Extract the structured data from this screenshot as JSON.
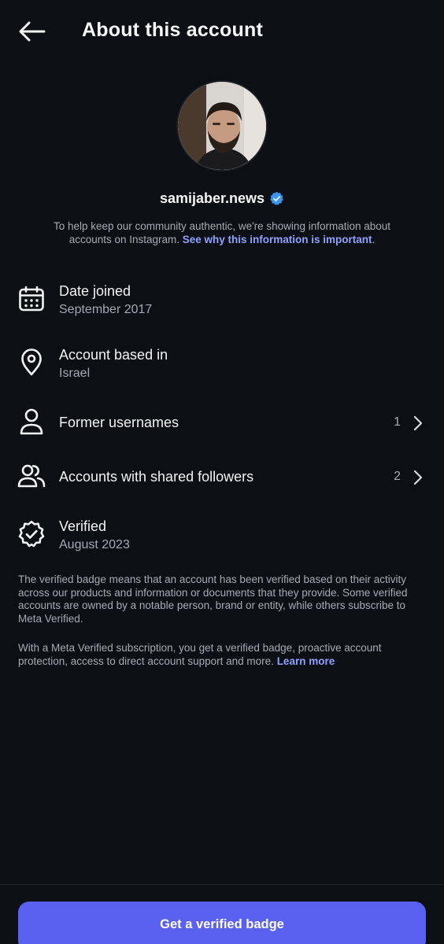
{
  "header": {
    "title": "About this account",
    "back_icon": "arrow-left-icon"
  },
  "profile": {
    "username": "samijaber.news",
    "verified_icon": "verified-badge-icon",
    "intro_text": "To help keep our community authentic, we're showing information about accounts on Instagram. ",
    "intro_link": "See why this information is important",
    "intro_end": "."
  },
  "rows": {
    "date_joined": {
      "title": "Date joined",
      "value": "September 2017",
      "icon": "calendar-icon"
    },
    "based_in": {
      "title": "Account based in",
      "value": "Israel",
      "icon": "location-pin-icon"
    },
    "former_usernames": {
      "title": "Former usernames",
      "count": "1",
      "icon": "person-icon"
    },
    "shared_followers": {
      "title": "Accounts with shared followers",
      "count": "2",
      "icon": "people-icon"
    },
    "verified": {
      "title": "Verified",
      "value": "August 2023",
      "icon": "verified-check-icon"
    }
  },
  "info": {
    "badge_paragraph": "The verified badge means that an account has been verified based on their activity across our products and information or documents that they provide. Some verified accounts are owned by a notable person, brand or entity, while others subscribe to Meta Verified.",
    "subscription_paragraph": "With a Meta Verified subscription, you get a verified badge, proactive account protection, access to direct account support and more. ",
    "learn_more": "Learn more"
  },
  "cta": {
    "label": "Get a verified badge"
  },
  "colors": {
    "background": "#0c0f14",
    "accent_link": "#8fa2ff",
    "button": "#5a60f0",
    "verified_blue": "#3897f0"
  }
}
